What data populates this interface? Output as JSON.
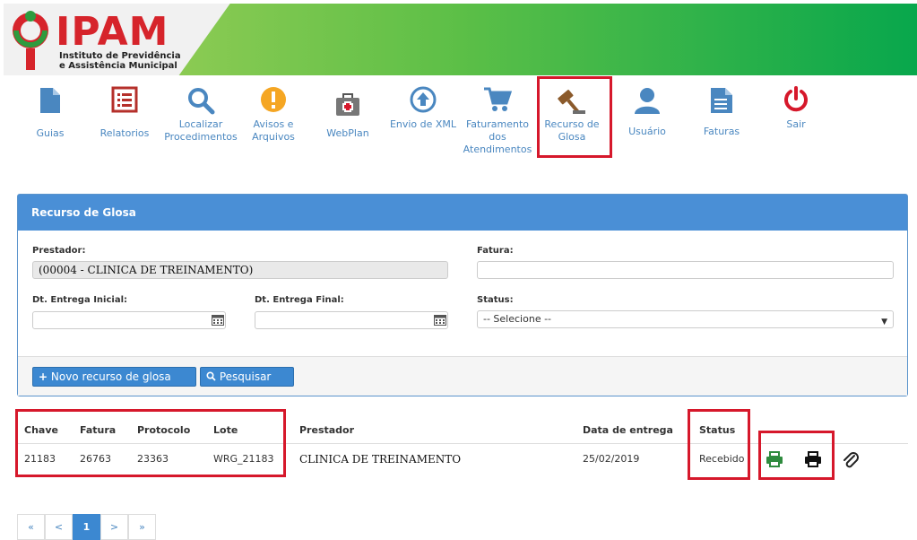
{
  "header": {
    "logo_name": "IPAM",
    "logo_sub_line1": "Instituto de Previdência",
    "logo_sub_line2": "e Assistência Municipal"
  },
  "nav": {
    "items": [
      {
        "line1": "Guias",
        "line2": "",
        "line3": "",
        "icon": "document-icon",
        "color": "#4a87c0"
      },
      {
        "line1": "Relatorios",
        "line2": "",
        "line3": "",
        "icon": "report-list-icon",
        "color": "#b5302b"
      },
      {
        "line1": "Localizar",
        "line2": "Procedimentos",
        "line3": "",
        "icon": "search-icon",
        "color": "#4a87c0"
      },
      {
        "line1": "Avisos e",
        "line2": "Arquivos",
        "line3": "",
        "icon": "alert-icon",
        "color": "#f5a623"
      },
      {
        "line1": "WebPlan",
        "line2": "",
        "line3": "",
        "icon": "first-aid-kit-icon",
        "color": "#666666"
      },
      {
        "line1": "Envio de XML",
        "line2": "",
        "line3": "",
        "icon": "upload-icon",
        "color": "#4a87c0"
      },
      {
        "line1": "Faturamento",
        "line2": "dos",
        "line3": "Atendimentos",
        "icon": "cart-icon",
        "color": "#4a87c0"
      },
      {
        "line1": "Recurso de",
        "line2": "Glosa",
        "line3": "",
        "icon": "gavel-icon",
        "color": "#8b5a2b"
      },
      {
        "line1": "Usuário",
        "line2": "",
        "line3": "",
        "icon": "user-icon",
        "color": "#4a87c0"
      },
      {
        "line1": "Faturas",
        "line2": "",
        "line3": "",
        "icon": "invoice-icon",
        "color": "#4a87c0"
      },
      {
        "line1": "Sair",
        "line2": "",
        "line3": "",
        "icon": "power-icon",
        "color": "#d6182b"
      }
    ]
  },
  "panel": {
    "title": "Recurso de Glosa",
    "prestador_label": "Prestador:",
    "prestador_value": "(00004 - CLINICA DE TREINAMENTO)",
    "fatura_label": "Fatura:",
    "fatura_value": "",
    "dt_inicial_label": "Dt. Entrega Inicial:",
    "dt_inicial_value": "",
    "dt_final_label": "Dt. Entrega Final:",
    "dt_final_value": "",
    "status_label": "Status:",
    "status_value": "-- Selecione --",
    "new_button": "Novo recurso de glosa",
    "search_button": "Pesquisar"
  },
  "table": {
    "headers": {
      "chave": "Chave",
      "fatura": "Fatura",
      "protocolo": "Protocolo",
      "lote": "Lote",
      "prestador": "Prestador",
      "data": "Data de entrega",
      "status": "Status"
    },
    "rows": [
      {
        "chave": "21183",
        "fatura": "26763",
        "protocolo": "23363",
        "lote": "WRG_21183",
        "prestador": "CLINICA DE TREINAMENTO",
        "data": "25/02/2019",
        "status": "Recebido"
      }
    ]
  },
  "pagination": {
    "first": "«",
    "prev": "<",
    "current": "1",
    "next": ">",
    "last": "»"
  },
  "colors": {
    "brand_red": "#d6242b",
    "accent_blue": "#4a8fd6",
    "highlight_red": "#d6182b",
    "print_green": "#2e8b3e"
  }
}
